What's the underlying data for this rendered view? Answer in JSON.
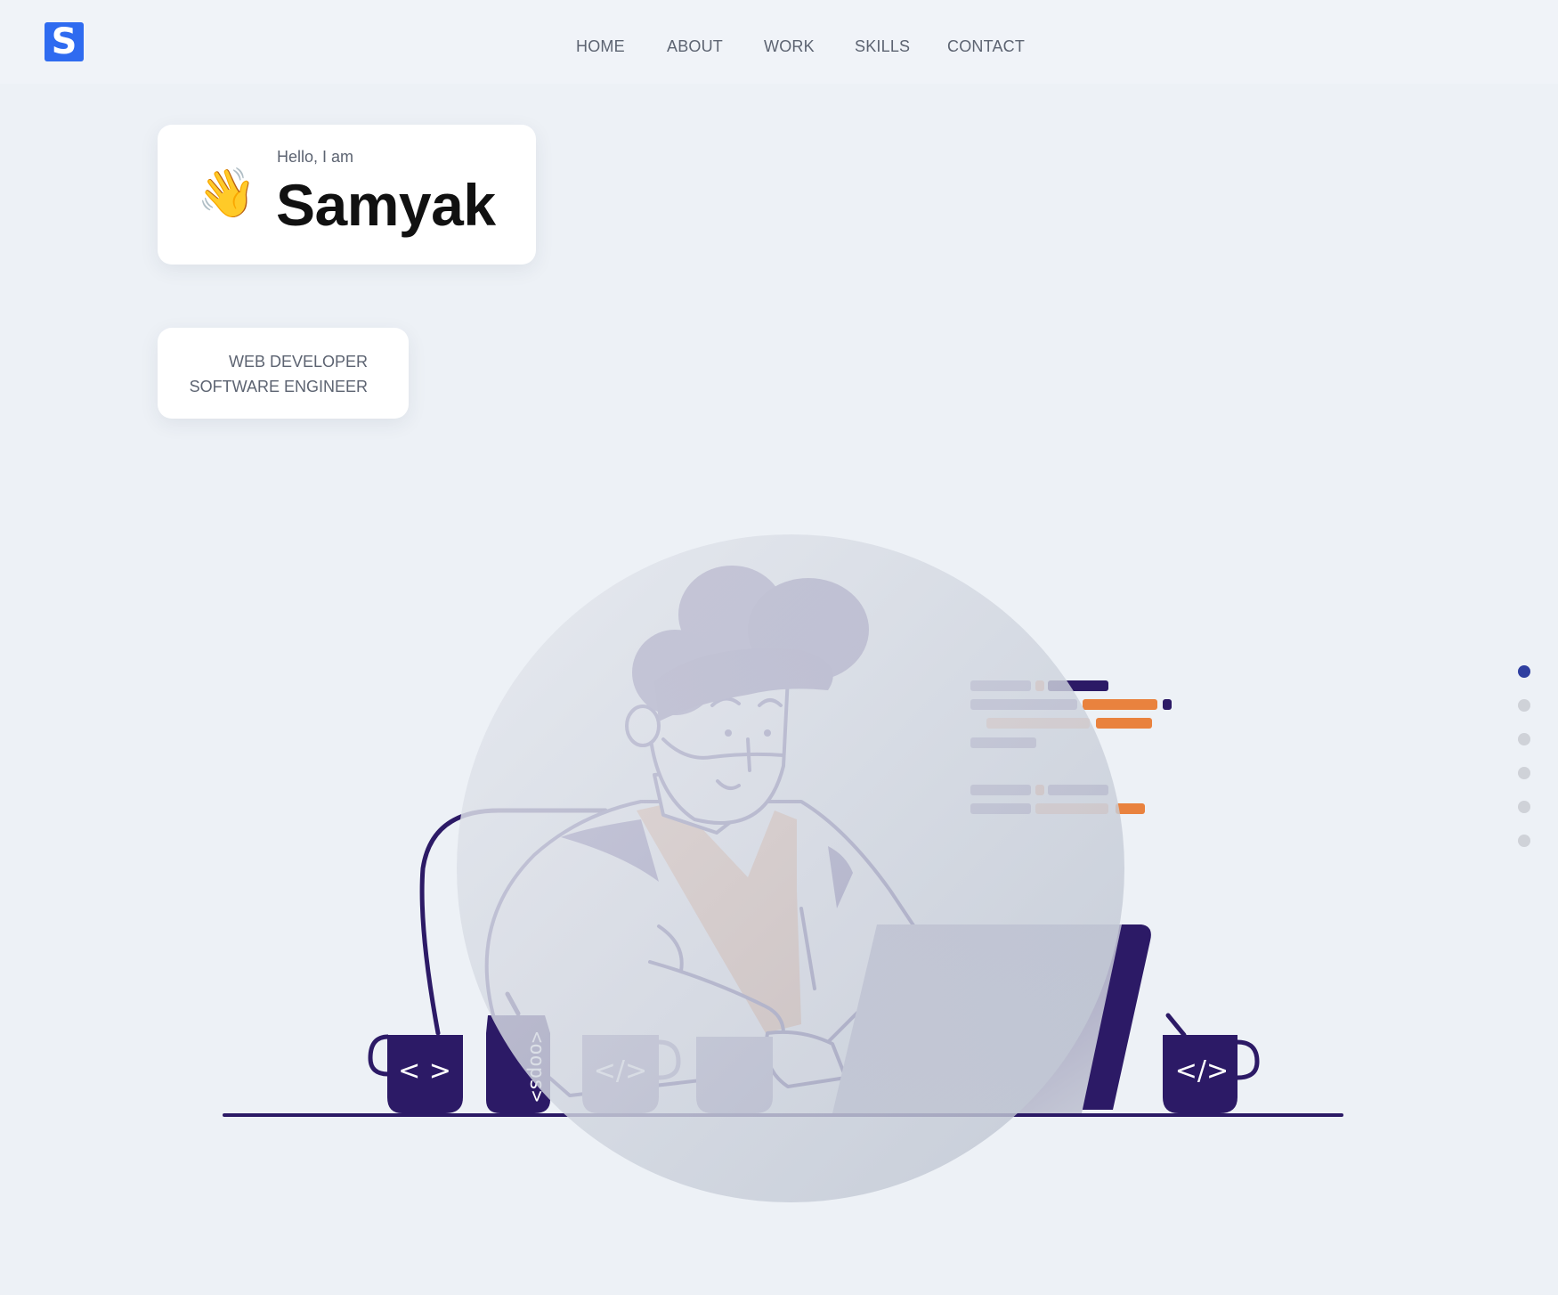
{
  "brand": {
    "logo_letter": "S",
    "logo_color": "#2f6bf0"
  },
  "nav": {
    "items": [
      {
        "label": "HOME"
      },
      {
        "label": "ABOUT"
      },
      {
        "label": "WORK"
      },
      {
        "label": "SKILLS"
      },
      {
        "label": "CONTACT"
      }
    ]
  },
  "hero": {
    "greeting": "Hello, I am",
    "name": "Samyak",
    "wave_emoji": "👋",
    "roles": [
      "WEB DEVELOPER",
      "SOFTWARE ENGINEER"
    ]
  },
  "illustration": {
    "mug_left_text": "< >",
    "can_text": "<oops>",
    "mug_middle_text": "</>",
    "mug_right_text": "</>"
  },
  "section_dots": {
    "count": 6,
    "active_index": 0
  },
  "colors": {
    "accent": "#2f3fa0",
    "dark_purple": "#2c1a66",
    "hair": "#3f2e78",
    "orange": "#e9823e",
    "background": "#edf1f6"
  }
}
